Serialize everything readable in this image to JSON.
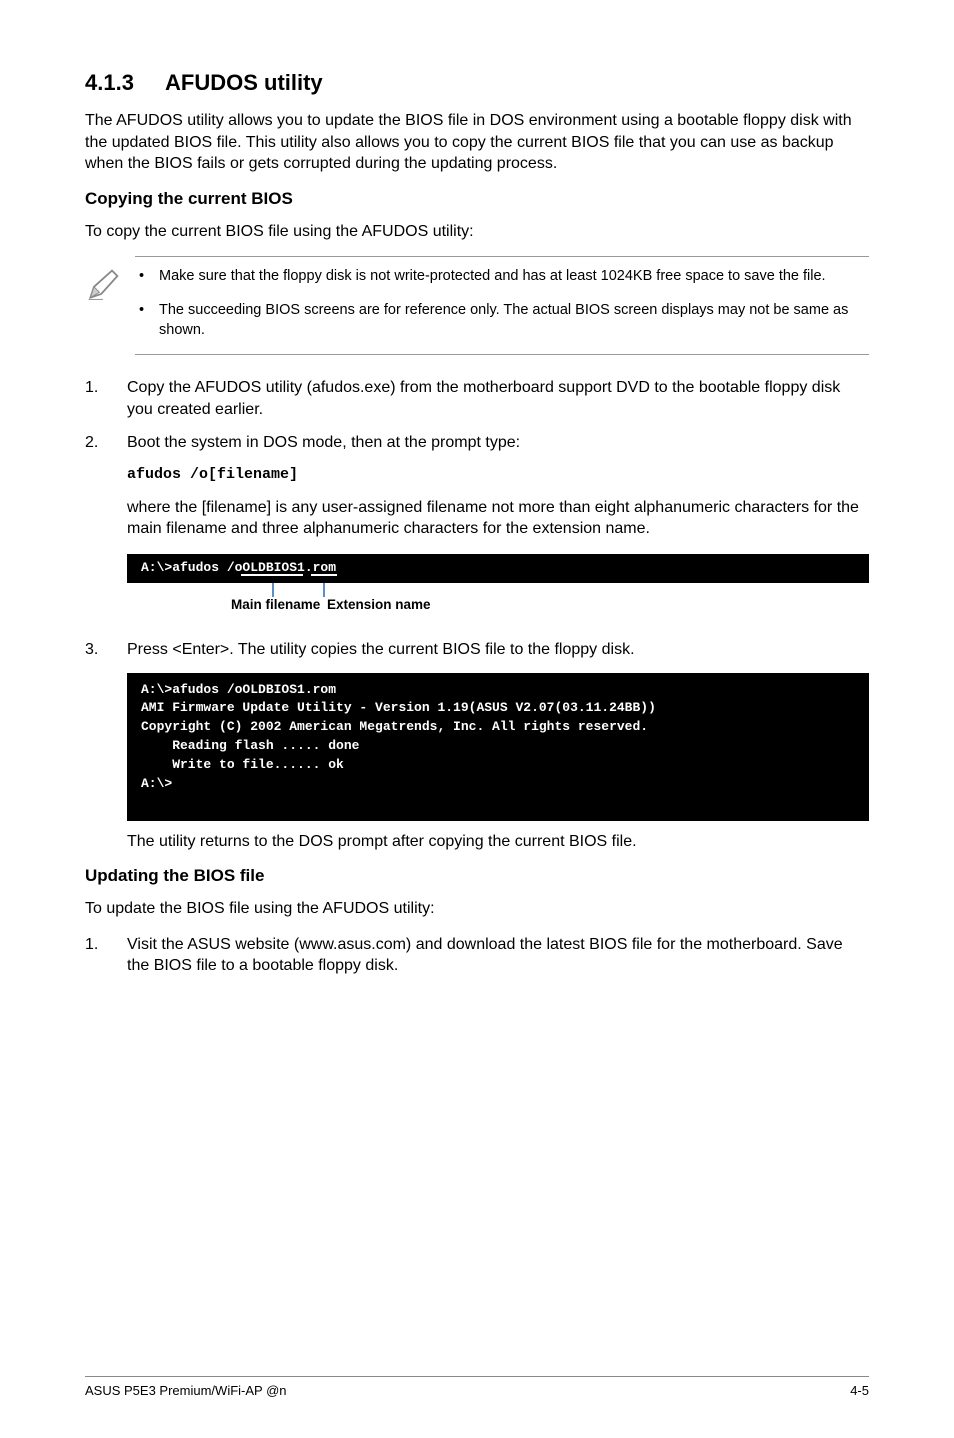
{
  "section": {
    "number": "4.1.3",
    "title": "AFUDOS utility"
  },
  "intro": "The AFUDOS utility allows you to update the BIOS file in DOS environment using a bootable floppy disk with the updated BIOS file. This utility also allows you to copy the current BIOS file that you can use as backup when the BIOS fails or gets corrupted during the updating process.",
  "copy": {
    "heading": "Copying the current BIOS",
    "lead": "To copy the current BIOS file using the AFUDOS utility:",
    "notes": [
      "Make sure that the floppy disk is not write-protected and has at least 1024KB free space to save the file.",
      "The succeeding BIOS screens are for reference only. The actual BIOS screen displays may not be same as shown."
    ],
    "step1": {
      "num": "1.",
      "text": "Copy the AFUDOS utility (afudos.exe) from the motherboard support DVD to the bootable floppy disk you created earlier."
    },
    "step2": {
      "num": "2.",
      "text": "Boot the system in DOS mode, then at the prompt type:"
    },
    "command": "afudos /o[filename]",
    "where": "where the [filename] is any user-assigned filename not more than eight alphanumeric characters  for the main filename and three alphanumeric characters for the extension name.",
    "diagram": {
      "line": "A:\\>afudos /oOLDBIOS1.rom",
      "main_label": "Main filename",
      "ext_label": "Extension name"
    },
    "step3": {
      "num": "3.",
      "text": "Press <Enter>. The utility copies the current BIOS file to the floppy disk."
    },
    "terminal": "A:\\>afudos /oOLDBIOS1.rom\nAMI Firmware Update Utility - Version 1.19(ASUS V2.07(03.11.24BB))\nCopyright (C) 2002 American Megatrends, Inc. All rights reserved.\n    Reading flash ..... done\n    Write to file...... ok\nA:\\>\n ",
    "after": "The utility returns to the DOS prompt after copying the current BIOS file."
  },
  "update": {
    "heading": "Updating the BIOS file",
    "lead": "To update the BIOS file using the AFUDOS utility:",
    "step1": {
      "num": "1.",
      "text": "Visit the ASUS website (www.asus.com) and download the latest BIOS file for the motherboard. Save the BIOS file to a bootable floppy disk."
    }
  },
  "footer": {
    "left": "ASUS P5E3 Premium/WiFi-AP @n",
    "right": "4-5"
  }
}
